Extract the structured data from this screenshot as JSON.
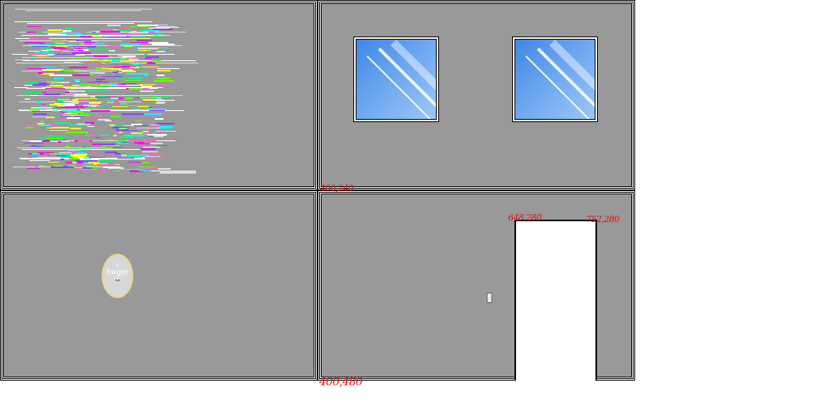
{
  "scene": {
    "rooms": [
      "top-left",
      "top-right",
      "bottom-left",
      "bottom-right"
    ],
    "sign": {
      "line1": "i",
      "line2": "forgor",
      "line3": "💀"
    },
    "annotations": [
      "400,240",
      "648,280",
      "752,280",
      "400,480"
    ],
    "colors": {
      "wall": "#999999",
      "window_sky": "#6aa6ef",
      "sign_rim": "#e8d48a",
      "annotation": "#e01010"
    }
  }
}
